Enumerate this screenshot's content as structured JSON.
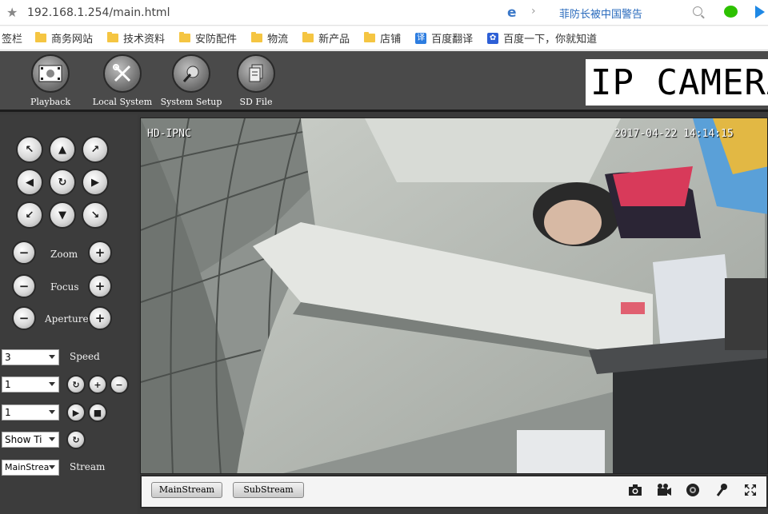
{
  "browser": {
    "url": "192.168.1.254/main.html",
    "search_hint": "菲防长被中国警告",
    "bookmarks_label": "签栏",
    "bookmarks": [
      {
        "label": "商务网站",
        "icon": "folder-icon"
      },
      {
        "label": "技术资料",
        "icon": "folder-icon"
      },
      {
        "label": "安防配件",
        "icon": "folder-icon"
      },
      {
        "label": "物流",
        "icon": "folder-icon"
      },
      {
        "label": "新产品",
        "icon": "folder-icon"
      },
      {
        "label": "店铺",
        "icon": "folder-icon"
      },
      {
        "label": "百度翻译",
        "icon": "translate-icon",
        "icon_text": "译"
      },
      {
        "label": "百度一下，你就知道",
        "icon": "baidu-paw-icon",
        "icon_text": "🐾"
      }
    ]
  },
  "app": {
    "brand": "IP CAMERA",
    "toolbar": [
      {
        "label": "Playback",
        "icon": "playback-film-icon"
      },
      {
        "label": "Local System",
        "icon": "tools-icon"
      },
      {
        "label": "System Setup",
        "icon": "wrench-gear-icon"
      },
      {
        "label": "SD File",
        "icon": "sd-file-icon"
      }
    ],
    "ptz": {
      "zoom_label": "Zoom",
      "focus_label": "Focus",
      "aperture_label": "Aperture",
      "speed_label": "Speed",
      "stream_label": "Stream"
    },
    "selects": {
      "speed_value": "3",
      "preset_value": "1",
      "cruise_value": "1",
      "osd_value": "Show Ti",
      "stream_value": "MainStrea"
    },
    "video": {
      "osd_name": "HD-IPNC",
      "osd_time": "2017-04-22 14:14:15"
    },
    "bottom": {
      "mainstream_label": "MainStream",
      "substream_label": "SubStream",
      "icons": [
        "camera-snapshot-icon",
        "record-video-icon",
        "speaker-icon",
        "microphone-icon",
        "fullscreen-icon"
      ]
    },
    "colors": {
      "panel_bg": "#3c3c3c",
      "topbar_bg": "#4a4a4a",
      "bookmark_folder": "#f5c542"
    }
  }
}
